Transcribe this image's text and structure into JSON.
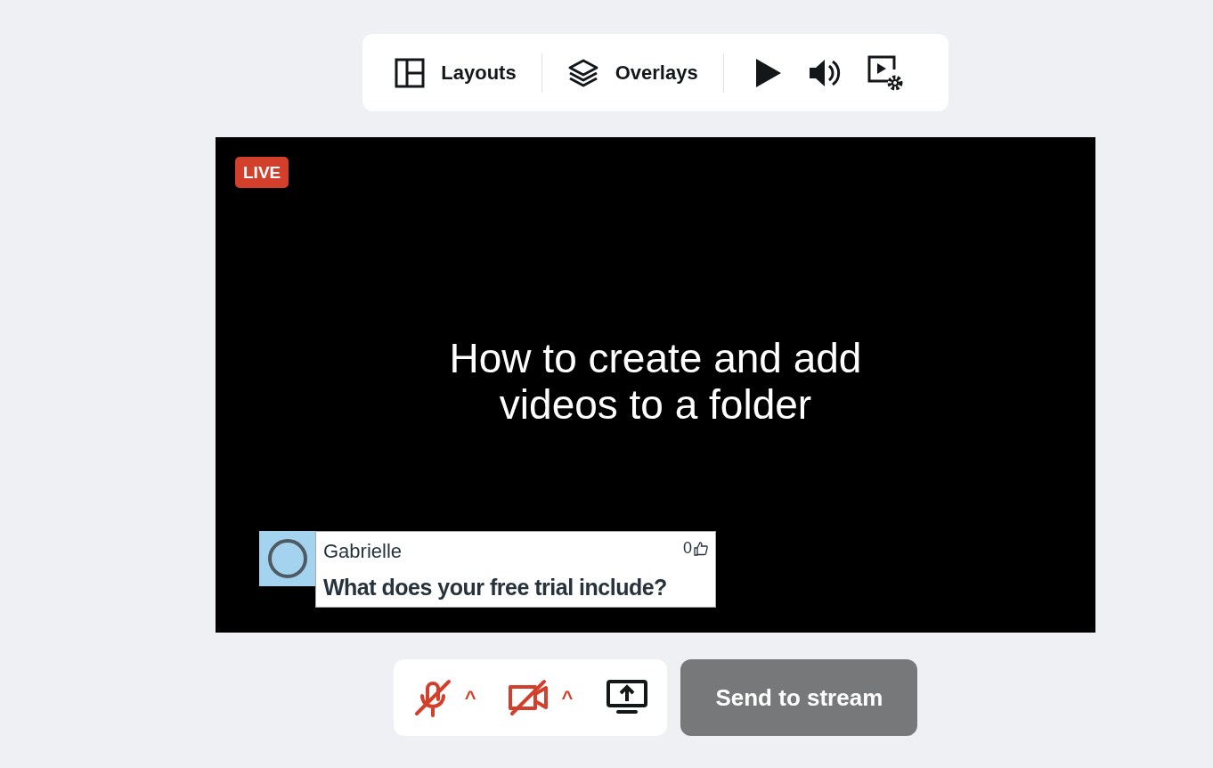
{
  "toolbar": {
    "items": [
      {
        "kind": "layouts",
        "label": "Layouts"
      },
      {
        "kind": "overlays",
        "label": "Overlays"
      },
      {
        "kind": "play"
      },
      {
        "kind": "volume"
      },
      {
        "kind": "video-settings"
      }
    ]
  },
  "stage": {
    "badge": "LIVE",
    "title": "How to create and add videos to a folder",
    "comment": {
      "author": "Gabrielle",
      "likes": "0",
      "text": "What does your free trial include?"
    }
  },
  "controls": {
    "microphone": {
      "muted": true,
      "caret": "^"
    },
    "camera": {
      "on": false,
      "caret": "^"
    },
    "send_button": {
      "label": "Send to stream",
      "disabled": true
    }
  }
}
